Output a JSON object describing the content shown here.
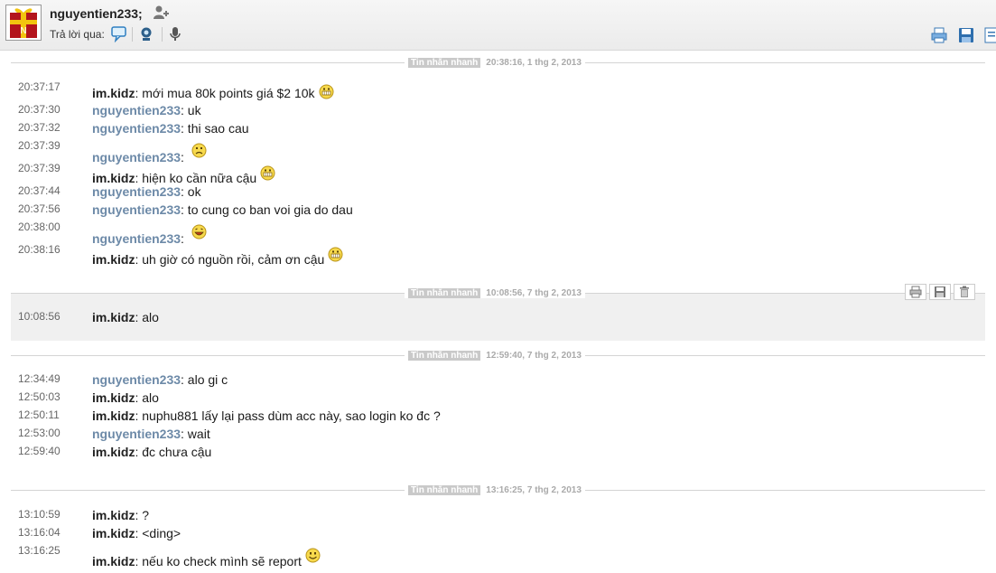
{
  "header": {
    "contact_name": "nguyentien233;",
    "reply_label": "Trả lời qua:"
  },
  "sessions": [
    {
      "tag": "Tin nhắn nhanh",
      "stamp": "20:38:16, 1 thg 2, 2013",
      "messages": [
        {
          "time": "20:37:17",
          "sender": "im.kidz",
          "text": ": mới mua 80k points giá $2 10k",
          "emoticon": "grin"
        },
        {
          "time": "20:37:30",
          "sender": "nguyentien233",
          "text": ": uk"
        },
        {
          "time": "20:37:32",
          "sender": "nguyentien233",
          "text": ": thi sao cau"
        },
        {
          "time": "20:37:39",
          "sender": "nguyentien233",
          "text": ": ",
          "emoticon": "confused"
        },
        {
          "time": "20:37:39",
          "sender": "im.kidz",
          "text": ": hiện ko cần nữa cậu",
          "emoticon": "grin"
        },
        {
          "time": "20:37:44",
          "sender": "nguyentien233",
          "text": ": ok"
        },
        {
          "time": "20:37:56",
          "sender": "nguyentien233",
          "text": ": to cung co ban voi gia do dau"
        },
        {
          "time": "20:38:00",
          "sender": "nguyentien233",
          "text": ": ",
          "emoticon": "laugh"
        },
        {
          "time": "20:38:16",
          "sender": "im.kidz",
          "text": ": uh giờ có nguồn rồi, cảm ơn cậu",
          "emoticon": "grin"
        }
      ]
    },
    {
      "tag": "Tin nhắn nhanh",
      "stamp": "10:08:56, 7 thg 2, 2013",
      "messages": [
        {
          "time": "10:08:56",
          "sender": "im.kidz",
          "text": ": alo"
        }
      ]
    },
    {
      "tag": "Tin nhắn nhanh",
      "stamp": "12:59:40, 7 thg 2, 2013",
      "messages": [
        {
          "time": "12:34:49",
          "sender": "nguyentien233",
          "text": ": alo gi c"
        },
        {
          "time": "12:50:03",
          "sender": "im.kidz",
          "text": ": alo"
        },
        {
          "time": "12:50:11",
          "sender": "im.kidz",
          "text": ": nuphu881 lấy lại pass dùm acc này, sao login ko đc ?"
        },
        {
          "time": "12:53:00",
          "sender": "nguyentien233",
          "text": ": wait"
        },
        {
          "time": "12:59:40",
          "sender": "im.kidz",
          "text": ": đc chưa cậu"
        }
      ]
    },
    {
      "tag": "Tin nhắn nhanh",
      "stamp": "13:16:25, 7 thg 2, 2013",
      "messages": [
        {
          "time": "13:10:59",
          "sender": "im.kidz",
          "text": ": ?"
        },
        {
          "time": "13:16:04",
          "sender": "im.kidz",
          "text": ": <ding>"
        },
        {
          "time": "13:16:25",
          "sender": "im.kidz",
          "text": ": nếu ko check mình sẽ report",
          "emoticon": "smile"
        }
      ]
    }
  ],
  "me": "im.kidz"
}
